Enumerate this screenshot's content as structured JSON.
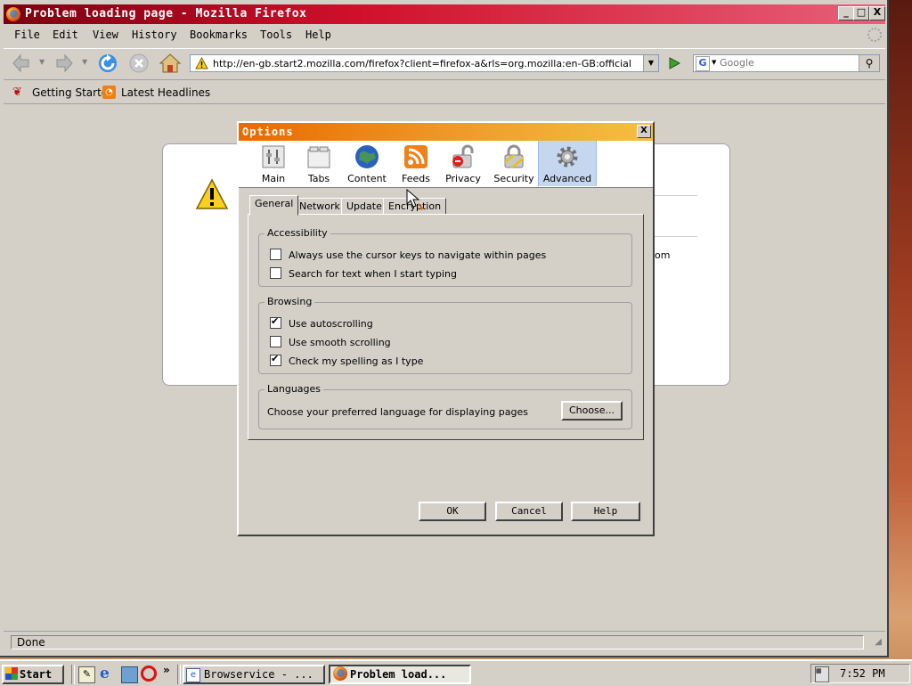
{
  "window": {
    "title": "Problem loading page - Mozilla Firefox",
    "controls": {
      "minimize": "_",
      "maximize": "□",
      "close": "X"
    }
  },
  "menubar": [
    "File",
    "Edit",
    "View",
    "History",
    "Bookmarks",
    "Tools",
    "Help"
  ],
  "navbar": {
    "url": "http://en-gb.start2.mozilla.com/firefox?client=firefox-a&rls=org.mozilla:en-GB:official",
    "search_placeholder": "Google"
  },
  "bookmarks": [
    "Getting Started",
    "Latest Headlines"
  ],
  "content": {
    "partial_text": "om"
  },
  "status": "Done",
  "dialog": {
    "title": "Options",
    "close": "X",
    "panes": [
      {
        "label": "Main",
        "icon": "main-pane-icon"
      },
      {
        "label": "Tabs",
        "icon": "tabs-pane-icon"
      },
      {
        "label": "Content",
        "icon": "content-globe-icon"
      },
      {
        "label": "Feeds",
        "icon": "rss-feed-icon"
      },
      {
        "label": "Privacy",
        "icon": "privacy-lock-icon"
      },
      {
        "label": "Security",
        "icon": "security-padlock-icon"
      },
      {
        "label": "Advanced",
        "icon": "gear-icon"
      }
    ],
    "selected_pane": "Advanced",
    "subtabs": [
      "General",
      "Network",
      "Update",
      "Encryption"
    ],
    "selected_subtab": "General",
    "groups": {
      "accessibility": {
        "title": "Accessibility",
        "options": [
          {
            "label": "Always use the cursor keys to navigate within pages",
            "checked": false
          },
          {
            "label": "Search for text when I start typing",
            "checked": false
          }
        ]
      },
      "browsing": {
        "title": "Browsing",
        "options": [
          {
            "label": "Use autoscrolling",
            "checked": true
          },
          {
            "label": "Use smooth scrolling",
            "checked": false
          },
          {
            "label": "Check my spelling as I type",
            "checked": true
          }
        ]
      },
      "languages": {
        "title": "Languages",
        "text": "Choose your preferred language for displaying pages",
        "button": "Choose..."
      }
    },
    "buttons": {
      "ok": "OK",
      "cancel": "Cancel",
      "help": "Help"
    }
  },
  "taskbar": {
    "start": "Start",
    "tasks": [
      "Browservice - ...",
      "Problem load..."
    ],
    "clock": "7:52 PM"
  },
  "colors": {
    "titlebar": "#d0102a",
    "dialog_titlebar": "#e86a00",
    "selected_pane": "#c5d7ef"
  }
}
